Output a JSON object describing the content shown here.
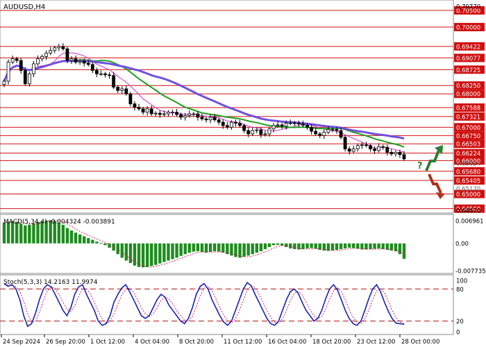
{
  "chart_data": [
    {
      "type": "candlestick",
      "title": "AUDUSD,H4",
      "x_ticks": [
        "24 Sep 2024",
        "26 Sep 20:00",
        "1 Oct 12:00",
        "4 Oct 04:00",
        "8 Oct 20:00",
        "11 Oct 12:00",
        "16 Oct 04:00",
        "18 Oct 20:00",
        "23 Oct 12:00",
        "28 Oct 00:00"
      ],
      "ylim": [
        0.6447,
        0.7077
      ],
      "axis_ticks": [
        0.7077,
        0.6447
      ],
      "price_levels": [
        {
          "label": "0.70500",
          "value": 0.705
        },
        {
          "label": "0.70000",
          "value": 0.7
        },
        {
          "label": "0.69422",
          "value": 0.69422
        },
        {
          "label": "0.69077",
          "value": 0.69077
        },
        {
          "label": "0.68725",
          "value": 0.68725
        },
        {
          "label": "0.68250",
          "value": 0.6825
        },
        {
          "label": "0.68000",
          "value": 0.68
        },
        {
          "label": "0.67588",
          "value": 0.67588
        },
        {
          "label": "0.67321",
          "value": 0.67321
        },
        {
          "label": "0.67000",
          "value": 0.67
        },
        {
          "label": "0.66750",
          "value": 0.6675
        },
        {
          "label": "0.66503",
          "value": 0.66503
        },
        {
          "label": "0.66224",
          "value": 0.66224
        },
        {
          "label": "0.66000",
          "value": 0.66
        },
        {
          "label": "0.65680",
          "value": 0.6568
        },
        {
          "label": "0.65405",
          "value": 0.65405
        },
        {
          "label": "0.65000",
          "value": 0.65
        },
        {
          "label": "0.64560",
          "value": 0.6456
        }
      ],
      "grey_labels": [
        {
          "label": "0.65170",
          "value": 0.6517
        },
        {
          "label": "0.65924",
          "value": 0.65924
        }
      ],
      "close_series": [
        0.6838,
        0.6895,
        0.6905,
        0.69,
        0.687,
        0.683,
        0.686,
        0.689,
        0.6905,
        0.6912,
        0.6922,
        0.693,
        0.6938,
        0.6942,
        0.6935,
        0.69,
        0.6905,
        0.6895,
        0.6898,
        0.6892,
        0.6888,
        0.687,
        0.686,
        0.686,
        0.6857,
        0.6855,
        0.682,
        0.681,
        0.6815,
        0.68,
        0.677,
        0.676,
        0.6755,
        0.6745,
        0.6755,
        0.674,
        0.6742,
        0.6738,
        0.674,
        0.6745,
        0.6745,
        0.6738,
        0.673,
        0.6735,
        0.674,
        0.674,
        0.673,
        0.6725,
        0.6722,
        0.673,
        0.6722,
        0.6715,
        0.6705,
        0.67,
        0.6715,
        0.6712,
        0.6705,
        0.669,
        0.668,
        0.669,
        0.6692,
        0.6678,
        0.668,
        0.6695,
        0.6705,
        0.6707,
        0.6703,
        0.6712,
        0.6713,
        0.6712,
        0.671,
        0.6706,
        0.67,
        0.6688,
        0.668,
        0.6675,
        0.6685,
        0.6693,
        0.6693,
        0.669,
        0.667,
        0.6635,
        0.6628,
        0.6635,
        0.6645,
        0.6647,
        0.6645,
        0.6635,
        0.663,
        0.6642,
        0.664,
        0.6625,
        0.662,
        0.6625,
        0.6618,
        0.6605
      ],
      "trend_arrows": {
        "up": "green",
        "down": "red",
        "label": "?"
      },
      "ma_colors": {
        "fast": "#d030d0",
        "mid": "#1e9e1e",
        "slow": "#7050e0"
      }
    },
    {
      "type": "bar",
      "title": "MACD(5,34,4) -0.004324 -0.003891",
      "axis_ticks": [
        0.006961,
        0.0,
        -0.007735
      ],
      "axis_labels": [
        "0.006961",
        "0.00",
        "-0.007735"
      ],
      "ylim": [
        -0.008,
        0.0075
      ],
      "color": "#1e8c1e",
      "signal_color": "#d02060",
      "values": [
        0.0058,
        0.006,
        0.0062,
        0.006,
        0.0055,
        0.005,
        0.0052,
        0.0056,
        0.006,
        0.0062,
        0.0064,
        0.0065,
        0.0063,
        0.0058,
        0.0052,
        0.0043,
        0.0036,
        0.003,
        0.0025,
        0.002,
        0.0015,
        0.001,
        0.0005,
        0.0001,
        -0.0005,
        -0.0012,
        -0.002,
        -0.003,
        -0.004,
        -0.0048,
        -0.0055,
        -0.0062,
        -0.0066,
        -0.0067,
        -0.0066,
        -0.0063,
        -0.006,
        -0.0056,
        -0.0052,
        -0.0048,
        -0.0044,
        -0.004,
        -0.0035,
        -0.003,
        -0.0026,
        -0.0023,
        -0.0022,
        -0.0024,
        -0.0026,
        -0.0024,
        -0.0022,
        -0.0023,
        -0.0026,
        -0.003,
        -0.0034,
        -0.0038,
        -0.004,
        -0.0037,
        -0.0034,
        -0.003,
        -0.0026,
        -0.0022,
        -0.0016,
        -0.001,
        -0.0005,
        -0.0004,
        -0.0006,
        -0.001,
        -0.0014,
        -0.0016,
        -0.0017,
        -0.0016,
        -0.0014,
        -0.0013,
        -0.0015,
        -0.0018,
        -0.002,
        -0.0021,
        -0.002,
        -0.0018,
        -0.0016,
        -0.0014,
        -0.0012,
        -0.0013,
        -0.0015,
        -0.0017,
        -0.0017,
        -0.0016,
        -0.0015,
        -0.0014,
        -0.0016,
        -0.0018,
        -0.002,
        -0.0022,
        -0.003,
        -0.0043
      ]
    },
    {
      "type": "line",
      "title": "Stoch(5,3,3) 14.2163 11.9974",
      "ylim": [
        0,
        100
      ],
      "axis_ticks": [
        100,
        80,
        20,
        0
      ],
      "levels": [
        80,
        20
      ],
      "main_color": "#1a20b0",
      "signal_color": "#d02060",
      "k_values": [
        90,
        85,
        88,
        80,
        60,
        30,
        10,
        15,
        35,
        60,
        80,
        88,
        84,
        70,
        55,
        40,
        30,
        45,
        70,
        84,
        88,
        70,
        55,
        40,
        20,
        12,
        15,
        30,
        55,
        70,
        82,
        88,
        75,
        60,
        45,
        30,
        25,
        30,
        45,
        60,
        70,
        65,
        50,
        40,
        30,
        20,
        15,
        25,
        45,
        70,
        85,
        90,
        80,
        60,
        45,
        30,
        18,
        12,
        20,
        40,
        60,
        80,
        92,
        86,
        70,
        55,
        40,
        25,
        15,
        12,
        20,
        40,
        60,
        75,
        80,
        72,
        55,
        40,
        30,
        20,
        25,
        40,
        62,
        80,
        88,
        78,
        60,
        40,
        25,
        15,
        12,
        20,
        40,
        62,
        80,
        88,
        75,
        55,
        38,
        24,
        16,
        15,
        14
      ]
    }
  ]
}
